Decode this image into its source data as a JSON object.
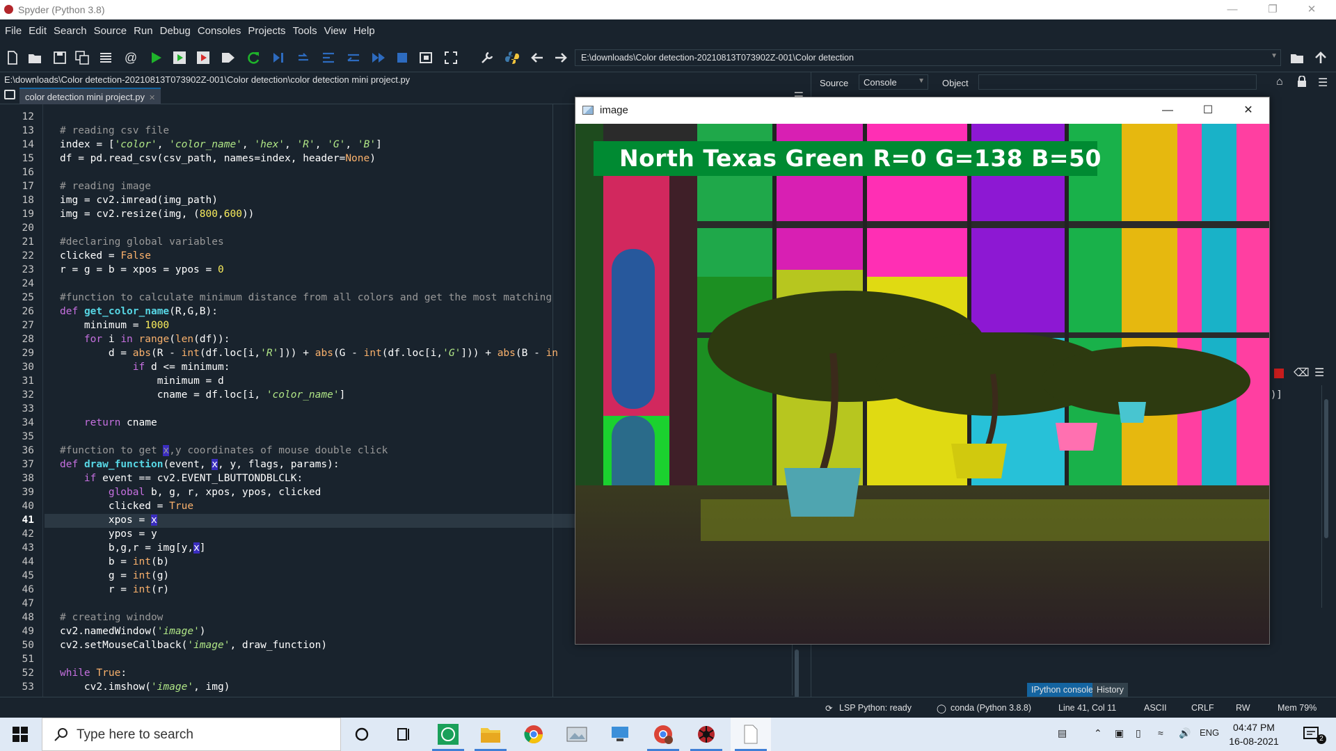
{
  "window": {
    "title": "Spyder (Python 3.8)"
  },
  "menu": [
    "File",
    "Edit",
    "Search",
    "Source",
    "Run",
    "Debug",
    "Consoles",
    "Projects",
    "Tools",
    "View",
    "Help"
  ],
  "toolbar": {
    "working_dir": "E:\\downloads\\Color detection-20210813T073902Z-001\\Color detection"
  },
  "editor": {
    "file_path": "E:\\downloads\\Color detection-20210813T073902Z-001\\Color detection\\color detection mini project.py",
    "tab_label": "color detection mini project.py",
    "current_line": 41,
    "line_numbers": [
      "12",
      "13",
      "14",
      "15",
      "16",
      "17",
      "18",
      "19",
      "20",
      "21",
      "22",
      "23",
      "24",
      "25",
      "26",
      "27",
      "28",
      "29",
      "30",
      "31",
      "32",
      "33",
      "34",
      "35",
      "36",
      "37",
      "38",
      "39",
      "40",
      "41",
      "42",
      "43",
      "44",
      "45",
      "46",
      "47",
      "48",
      "49",
      "50",
      "51",
      "52",
      "53"
    ],
    "code": {
      "l13": "# reading csv file",
      "l14_a": "index = [",
      "l14_s1": "'color'",
      "l14_s2": "'color_name'",
      "l14_s3": "'hex'",
      "l14_s4": "'R'",
      "l14_s5": "'G'",
      "l14_s6": "'B'",
      "l15_a": "df = pd.read_csv(csv_path, names=index, header=",
      "l15_b": "None",
      "l17": "# reading image",
      "l18": "img = cv2.imread(img_path)",
      "l19_a": "img = cv2.resize(img, (",
      "l19_b": "800",
      "l19_c": "600",
      "l21": "#declaring global variables",
      "l22_a": "clicked = ",
      "l22_b": "False",
      "l23_a": "r = g = b = xpos = ypos = ",
      "l23_b": "0",
      "l25": "#function to calculate minimum distance from all colors and get the most matching",
      "l26_kw": "def",
      "l26_fn": "get_color_name",
      "l26_rest": "(R,G,B):",
      "l27_a": "minimum = ",
      "l27_b": "1000",
      "l28_for": "for",
      "l28_i": " i ",
      "l28_in": "in",
      "l28_range": "range",
      "l28_len": "len",
      "l28_rest": "(df)):",
      "l29_a": "d = ",
      "l29_abs": "abs",
      "l29_b": "(R - ",
      "l29_int": "int",
      "l29_c": "(df.loc[i,",
      "l29_s1": "'R'",
      "l29_d": "])) + ",
      "l29_e": "(G - ",
      "l29_s2": "'G'",
      "l29_f": "(B - ",
      "l29_g": "in",
      "l30_if": "if",
      "l30_rest": " d <= minimum:",
      "l31": "minimum = d",
      "l32_a": "cname = df.loc[i, ",
      "l32_s": "'color_name'",
      "l34_ret": "return",
      "l34_rest": " cname",
      "l36_a": "#function to get ",
      "l36_x": "x",
      "l36_b": ",y coordinates of mouse double click",
      "l37_def": "def",
      "l37_fn": "draw_function",
      "l37_a": "(event, ",
      "l37_x": "x",
      "l37_b": ", y, flags, params):",
      "l38_if": "if",
      "l38_rest": " event == cv2.EVENT_LBUTTONDBLCLK:",
      "l39_g": "global",
      "l39_rest": " b, g, r, xpos, ypos, clicked",
      "l40_a": "clicked = ",
      "l40_b": "True",
      "l41_a": "xpos = ",
      "l41_x": "x",
      "l42": "ypos = y",
      "l43_a": "b,g,r = img[y,",
      "l43_x": "x",
      "l43_b": "]",
      "l44_a": "b = ",
      "l44_b": "(b)",
      "l45_a": "g = ",
      "l45_b": "(g)",
      "l46_a": "r = ",
      "l46_b": "(r)",
      "l48": "# creating window",
      "l49_a": "cv2.namedWindow(",
      "l49_s": "'image'",
      "l50_a": "cv2.setMouseCallback(",
      "l50_s": "'image'",
      "l50_b": ", draw_function)",
      "l52_w": "while",
      "l52_t": "True",
      "l53_a": "cv2.imshow(",
      "l53_s": "'image'",
      "l53_b": ", img)"
    }
  },
  "help_pane": {
    "source_label": "Source",
    "source_value": "Console",
    "object_label": "Object"
  },
  "console": {
    "partial_text": ")]"
  },
  "console_tabs": [
    "IPython console",
    "History"
  ],
  "status": {
    "lsp": "LSP Python: ready",
    "env": "conda (Python 3.8.8)",
    "position": "Line 41, Col 11",
    "encoding": "ASCII",
    "eol": "CRLF",
    "perm": "RW",
    "mem": "Mem 79%"
  },
  "image_window": {
    "title": "image",
    "banner_text": "North Texas Green R=0 G=138 B=50",
    "banner_color": "#008a32"
  },
  "taskbar": {
    "search_placeholder": "Type here to search",
    "language": "ENG",
    "time": "04:47 PM",
    "date": "16-08-2021",
    "notification_count": "2"
  },
  "colors": {
    "editor_bg": "#19232d",
    "accent": "#1464a0",
    "selection": "#3a2dbf"
  }
}
